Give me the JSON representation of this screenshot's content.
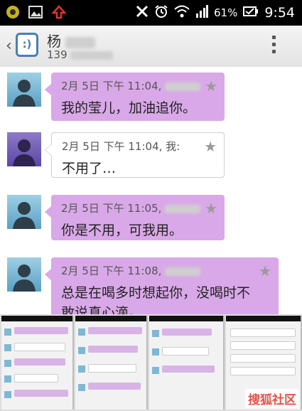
{
  "status_bar": {
    "battery_percent": "61%",
    "time": "9:54",
    "icons": [
      "alarm-clock-icon",
      "wifi-icon",
      "signal-icon",
      "battery-icon",
      "mute-icon"
    ]
  },
  "header": {
    "contact_name": "杨",
    "contact_number": "139"
  },
  "messages": [
    {
      "meta": "2月 5日 下午 11:04,",
      "body_lines": [
        "我的莹儿，加油追你。"
      ],
      "direction": "in"
    },
    {
      "meta": "2月 5日 下午 11:04, 我:",
      "body_lines": [
        "不用了…"
      ],
      "direction": "out"
    },
    {
      "meta": "2月 5日 下午 11:05,",
      "body_lines": [
        "你是不用，可我用。"
      ],
      "direction": "in"
    },
    {
      "meta": "2月 5日 下午 11:08,",
      "body_lines": [
        "总是在喝多时想起你，没喝时不",
        "敢说真心滴。"
      ],
      "direction": "in"
    }
  ],
  "watermark": "搜狐社区",
  "colors": {
    "incoming_bubble": "#d9a8e8",
    "outgoing_bubble": "#ffffff",
    "header_icon": "#4a7fb2"
  }
}
